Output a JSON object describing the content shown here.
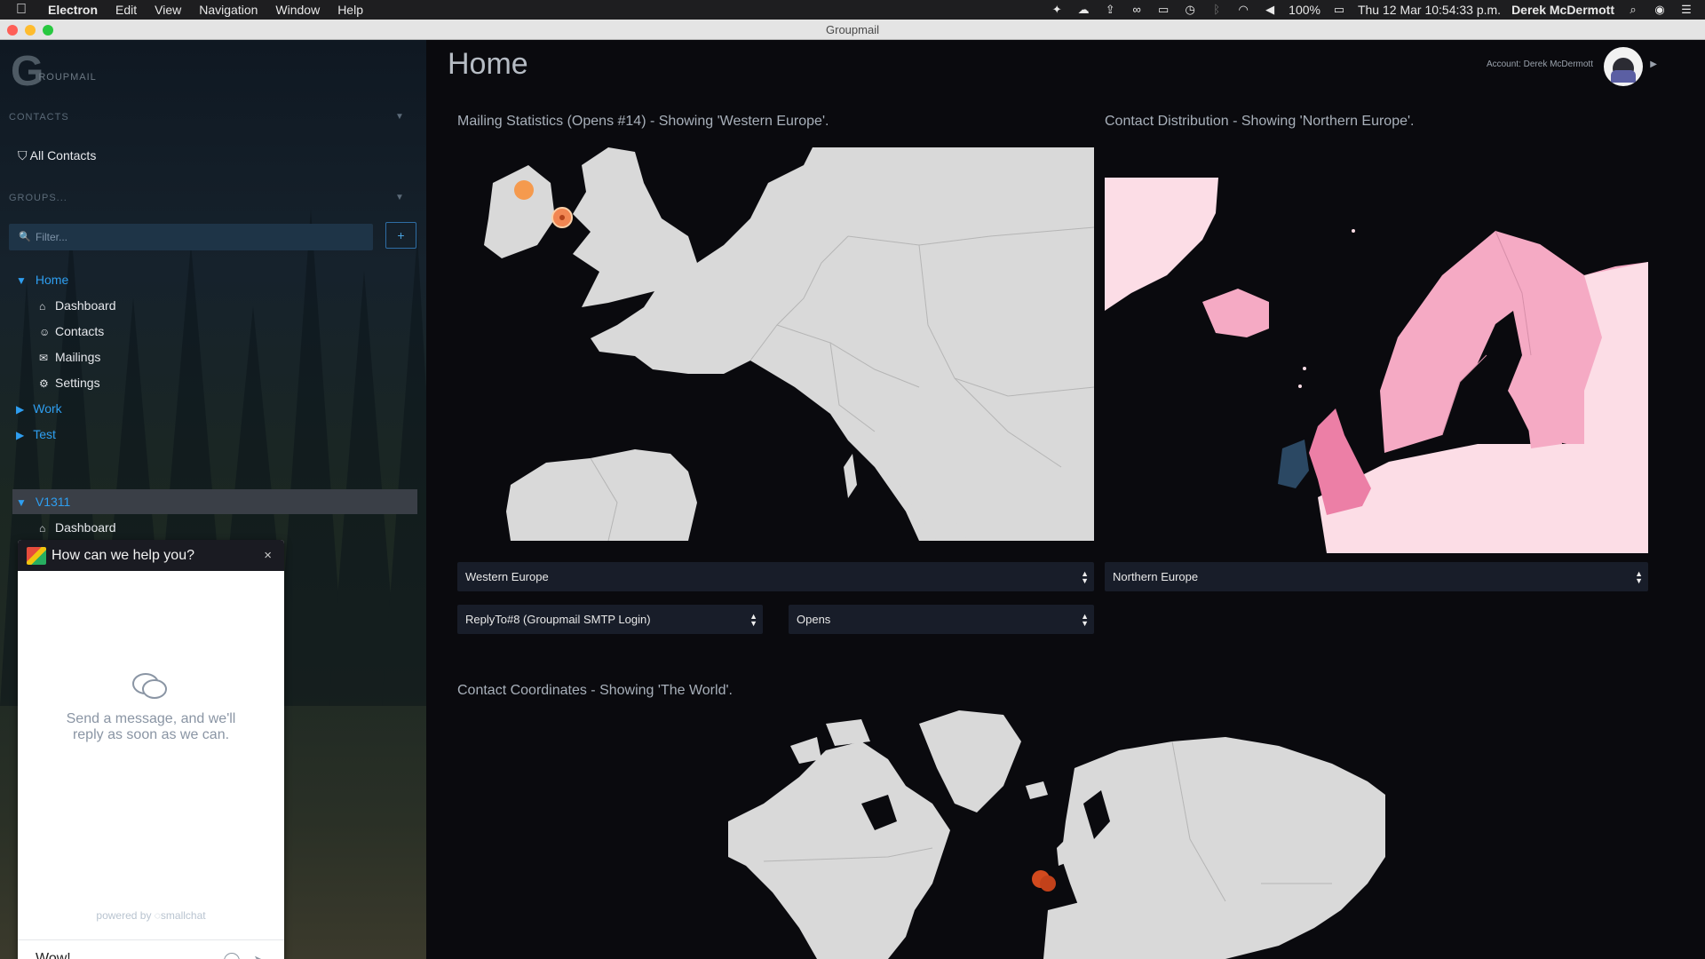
{
  "menubar": {
    "app": "Electron",
    "menus": [
      "Edit",
      "View",
      "Navigation",
      "Window",
      "Help"
    ],
    "battery": "100%",
    "datetime": "Thu 12 Mar  10:54:33 p.m.",
    "user": "Derek McDermott"
  },
  "window": {
    "title": "Groupmail"
  },
  "sidebar": {
    "logo_text": "ROUPMAIL",
    "contacts_header": "CONTACTS",
    "all_contacts": "All Contacts",
    "groups_header": "GROUPS...",
    "filter_placeholder": "Filter...",
    "add_label": "+",
    "tree": {
      "home": "Home",
      "home_children": [
        "Dashboard",
        "Contacts",
        "Mailings",
        "Settings"
      ],
      "work": "Work",
      "test": "Test",
      "v1311": "V1311",
      "v1311_children": [
        "Dashboard"
      ]
    }
  },
  "chat": {
    "title": "How can we help you?",
    "close": "×",
    "message": "Send a message, and we'll reply as soon as we can.",
    "powered_by": "powered by ◌smallchat",
    "input_value": "Wow!"
  },
  "main": {
    "title": "Home",
    "account": "Account: Derek McDermott",
    "panels": {
      "mailing": "Mailing Statistics (Opens #14) - Showing 'Western Europe'.",
      "distribution": "Contact Distribution - Showing 'Northern Europe'.",
      "coordinates": "Contact Coordinates - Showing 'The World'."
    },
    "selects": {
      "region_left": "Western Europe",
      "region_right": "Northern Europe",
      "reply_to": "ReplyTo#8 (Groupmail SMTP Login)",
      "metric": "Opens"
    }
  },
  "colors": {
    "accent": "#2e9ef0",
    "map_land": "#d9d9d9",
    "map_sea": "#0a0a0e",
    "marker_orange": "#f59a4e",
    "marker_red": "#d24a1e",
    "pink_light": "#fcdde6",
    "pink_mid": "#f5aac4",
    "pink_dark": "#ec7fa6",
    "uk_blue": "#2b4863"
  },
  "icons": {
    "apple": "apple-icon",
    "search": "search-icon",
    "filter": "filter-icon",
    "home": "home-icon",
    "contacts": "users-icon",
    "mail": "envelope-icon",
    "settings": "gear-icon"
  }
}
